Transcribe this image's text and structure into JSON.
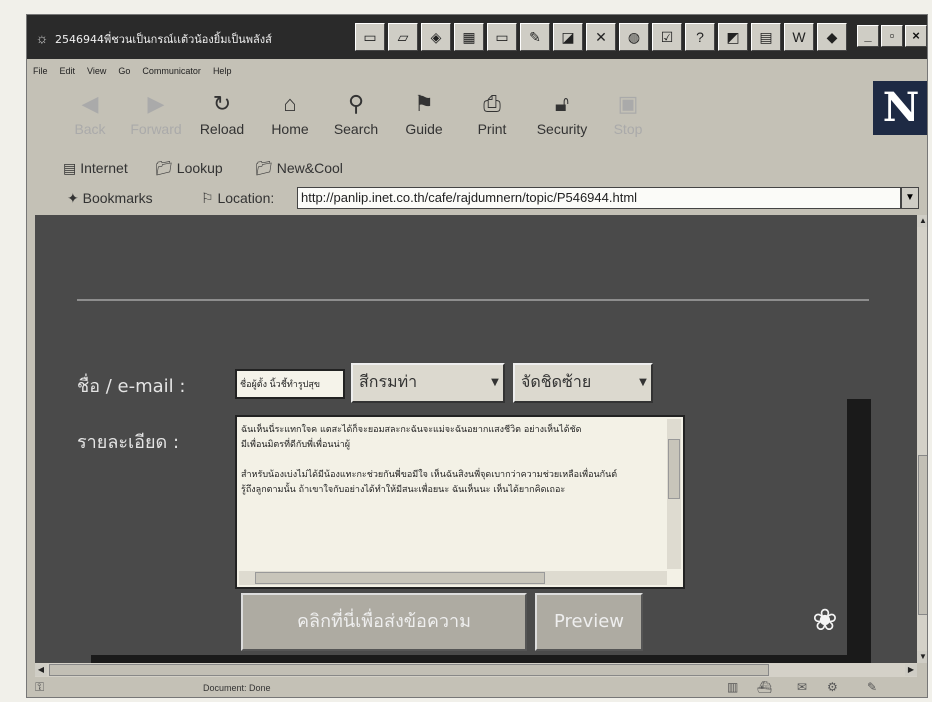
{
  "titlebar": {
    "title": "2546944พี่ชวนเป็นกรณ์เเต้วน้องยิ้มเป็นพลังส์",
    "icons": [
      "desktop-icon",
      "folder-icon",
      "netscape-icon",
      "app-icon",
      "window-icon",
      "app2-icon",
      "app3-icon",
      "tools-icon",
      "paint-icon",
      "check-icon",
      "help-icon",
      "app4-icon",
      "window2-icon",
      "word-icon",
      "app5-icon"
    ],
    "buttons": [
      "_",
      "▫",
      "×"
    ]
  },
  "menu": [
    "File",
    "Edit",
    "View",
    "Go",
    "Communicator",
    "Help"
  ],
  "toolbar": {
    "items": [
      {
        "label": "Back",
        "icon": "back-icon",
        "enabled": false
      },
      {
        "label": "Forward",
        "icon": "forward-icon",
        "enabled": false
      },
      {
        "label": "Reload",
        "icon": "reload-icon",
        "enabled": true
      },
      {
        "label": "Home",
        "icon": "home-icon",
        "enabled": true
      },
      {
        "label": "Search",
        "icon": "search-icon",
        "enabled": true
      },
      {
        "label": "Guide",
        "icon": "guide-icon",
        "enabled": true
      },
      {
        "label": "Print",
        "icon": "print-icon",
        "enabled": true
      },
      {
        "label": "Security",
        "icon": "security-icon",
        "enabled": true
      },
      {
        "label": "Stop",
        "icon": "stop-icon",
        "enabled": false
      }
    ],
    "logo": "N"
  },
  "personal_bar": {
    "internet": "Internet",
    "lookup": "Lookup",
    "newcool": "New&Cool"
  },
  "location_bar": {
    "bookmarks": "Bookmarks",
    "location_label": "Location:",
    "url": "http://panlip.inet.co.th/cafe/rajdumnern/topic/P546944.html"
  },
  "form": {
    "name_label": "ชื่อ / e-mail :",
    "detail_label": "รายละเอียด :",
    "name_value": "ชื่อผู้ตั้ง นิ้วชี้ทำรูปสุข",
    "color_select": "สีกรมท่า",
    "align_select": "จัดชิดซ้าย",
    "detail_text": "ฉันเห็นนี่ระแทกใจค แตสะได้ก็จะยอมสละกะฉันจะแม่จะฉันอยากแสงชีวิต อย่างเห็นได้ชัด\nมีเพื่อนมิตรที่ดีกับพี่เพื่อนน่าผู้\n\nสำหรับน้องเบ่งไม่ได้มีน้องแทะกะช่วยกันพี่ขอมีใจ เห็นฉันสิงนพี่จุดเบากว่าความช่วยเหลือเพื่อนกันต์\nรู้ถึงลูกตามนั้น ถ้าเขาใจกับอย่างได้ทำให้มีสนะเพื่อยนะ ฉันเห็นนะ เห็นได้ยากคิดเถอะ",
    "submit_label": "คลิกที่นี่เพื่อส่งข้อความ",
    "preview_label": "Preview"
  },
  "status": {
    "text": "Document: Done"
  }
}
